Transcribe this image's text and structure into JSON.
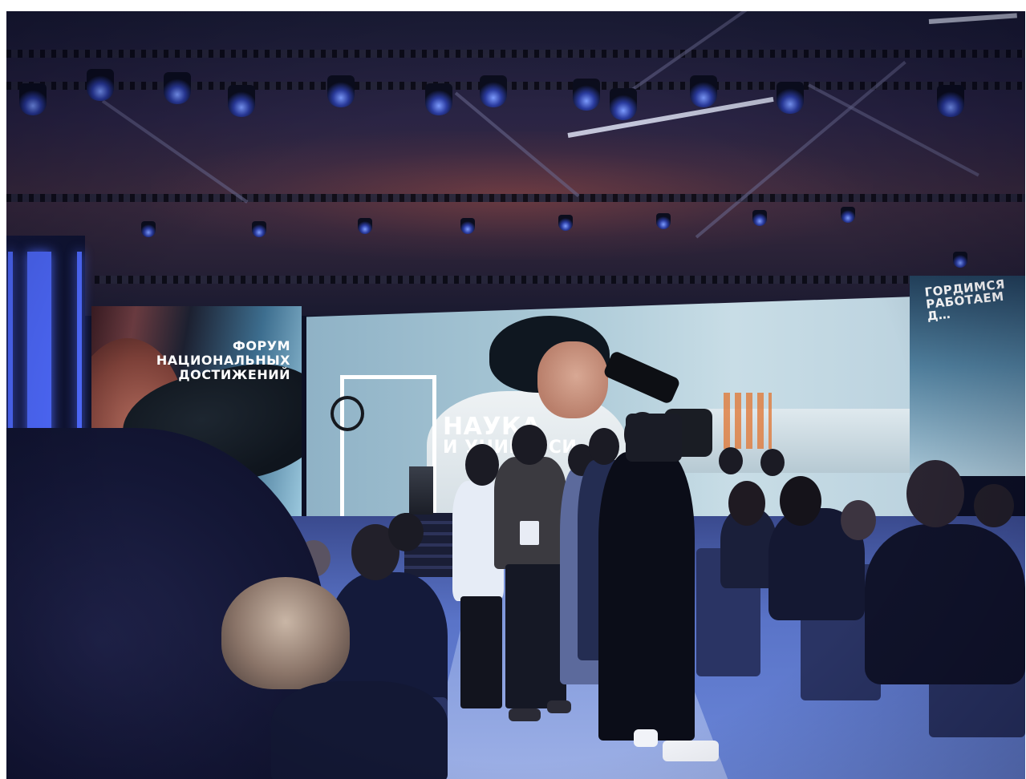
{
  "photo": {
    "left_screen": {
      "lines": [
        "ФОРУМ",
        "НАЦИОНАЛЬНЫХ",
        "ДОСТИЖЕНИЙ"
      ]
    },
    "main_screen": {
      "title": "НАУКА",
      "subtitle": "И УНИВЕРСИ…"
    },
    "right_screen": {
      "lines": [
        "ГОРДИМСЯ",
        "РАБОТАЕМ Д…"
      ]
    }
  },
  "colors": {
    "accent_blue": "#4f6bff",
    "floor_blue": "#6a86d8",
    "screen_sky": "#a9c8d6"
  }
}
